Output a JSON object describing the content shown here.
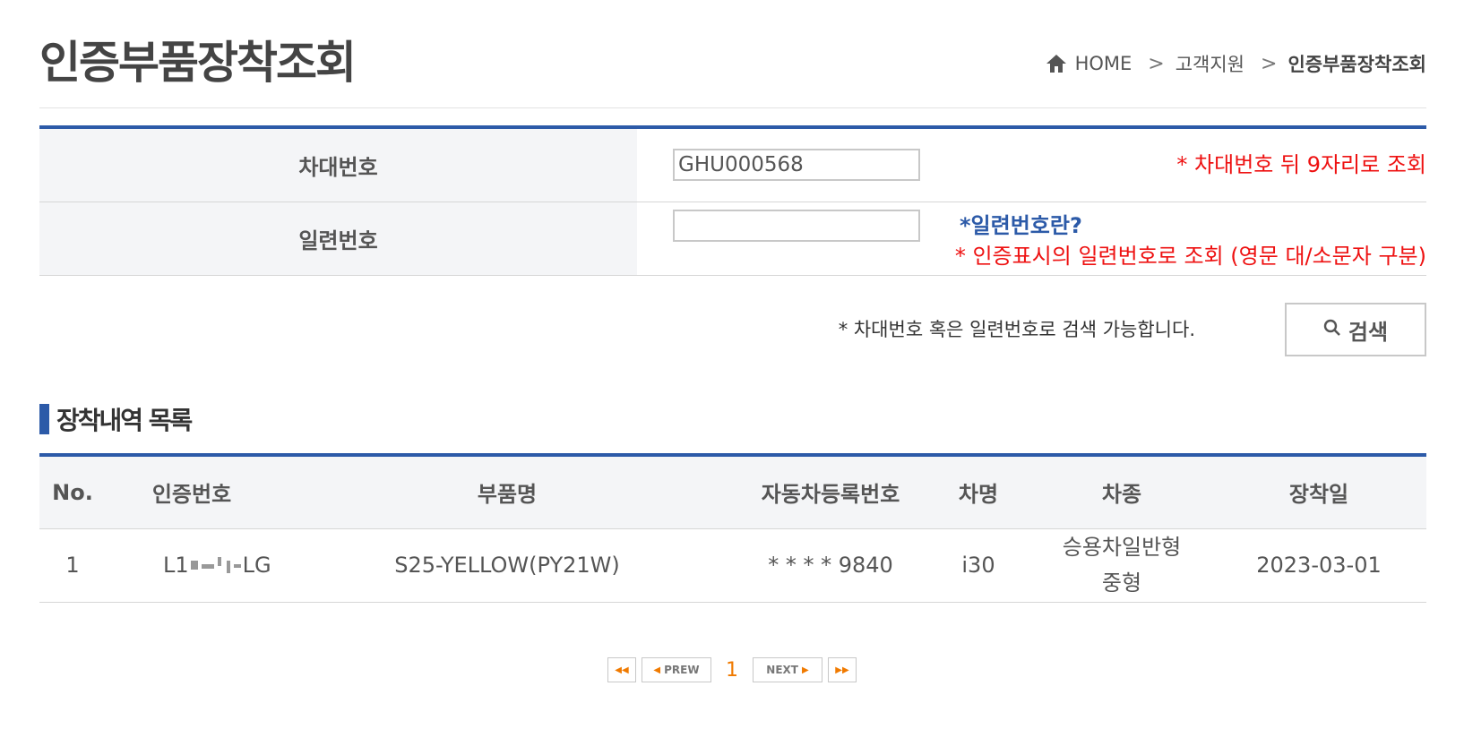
{
  "page": {
    "title": "인증부품장착조회"
  },
  "breadcrumb": {
    "home": "HOME",
    "sep": ">",
    "level1": "고객지원",
    "current": "인증부품장착조회"
  },
  "form": {
    "vin_label": "차대번호",
    "vin_value": "GHU000568",
    "vin_note": "* 차대번호 뒤 9자리로 조회",
    "serial_label": "일련번호",
    "serial_value": "",
    "serial_link": "*일련번호란?",
    "serial_note": "* 인증표시의 일련번호로 조회 (영문 대/소문자 구분)",
    "hint": "* 차대번호 혹은 일련번호로 검색 가능합니다.",
    "search_button": "검색"
  },
  "section": {
    "title": "장착내역 목록"
  },
  "table": {
    "headers": [
      "No.",
      "인증번호",
      "부품명",
      "자동차등록번호",
      "차명",
      "차종",
      "장착일"
    ],
    "rows": [
      {
        "no": "1",
        "cert_prefix": "L1",
        "cert_suffix": "LG",
        "part": "S25-YELLOW(PY21W)",
        "reg": "* * * * 9840",
        "model": "i30",
        "type_line1": "승용차일반형",
        "type_line2": "중형",
        "date": "2023-03-01"
      }
    ]
  },
  "pager": {
    "prev": "PREW",
    "next": "NEXT",
    "page": "1"
  },
  "colors": {
    "accent": "#2c5aa8",
    "note_red": "#ee1111",
    "pager_orange": "#f07a00"
  }
}
